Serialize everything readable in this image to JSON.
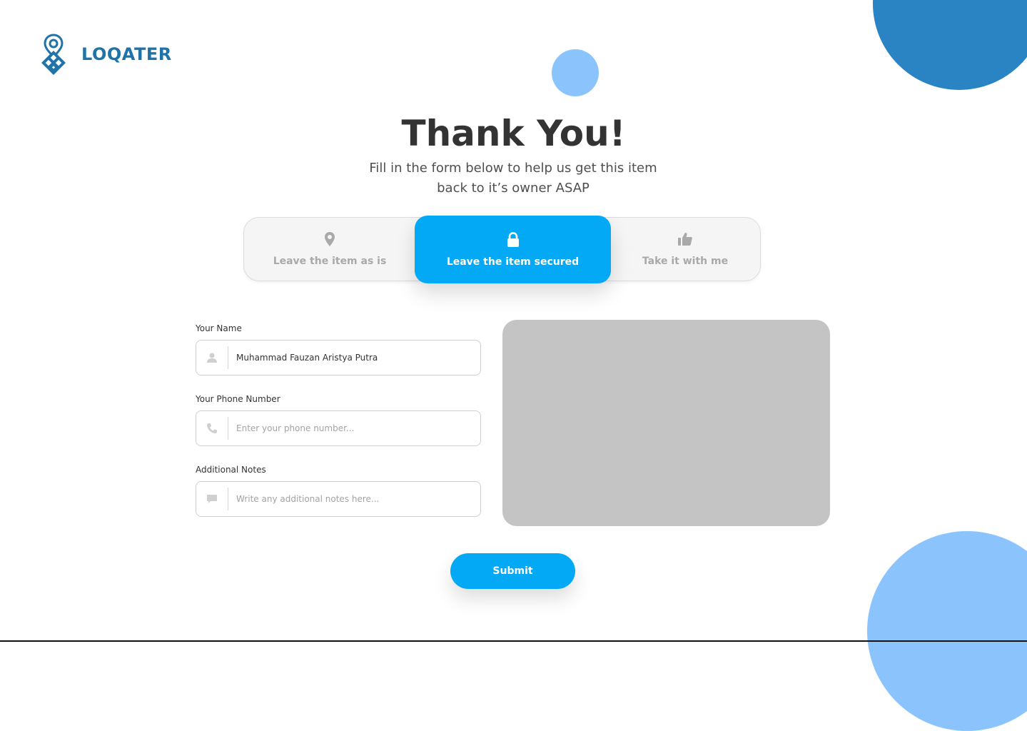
{
  "brand": {
    "name": "LOQATER",
    "logo_icon": "location-pin-qr-icon",
    "color": "#1f73a8"
  },
  "header": {
    "title": "Thank You!",
    "subtitle_line1": "Fill in the form below to help us get this item",
    "subtitle_line2": "back to it’s owner ASAP"
  },
  "options": {
    "selected": "Leave the item secured",
    "items": [
      {
        "label": "Leave the item as is",
        "icon": "map-pin-icon"
      },
      {
        "label": "Leave the item secured",
        "icon": "lock-icon"
      },
      {
        "label": "Take it with me",
        "icon": "thumbs-up-icon"
      }
    ]
  },
  "form": {
    "name": {
      "label": "Your Name",
      "value": "Muhammad Fauzan Aristya Putra",
      "icon": "user-icon"
    },
    "phone": {
      "label": "Your Phone Number",
      "placeholder": "Enter your phone number...",
      "icon": "phone-icon"
    },
    "notes": {
      "label": "Additional Notes",
      "placeholder": "Write any additional notes here...",
      "icon": "comment-icon"
    },
    "submit_label": "Submit"
  },
  "colors": {
    "accent": "#03a9f4",
    "brand": "#1f73a8",
    "light_blue": "#8bc4fc",
    "image_placeholder": "#c4c4c4"
  }
}
